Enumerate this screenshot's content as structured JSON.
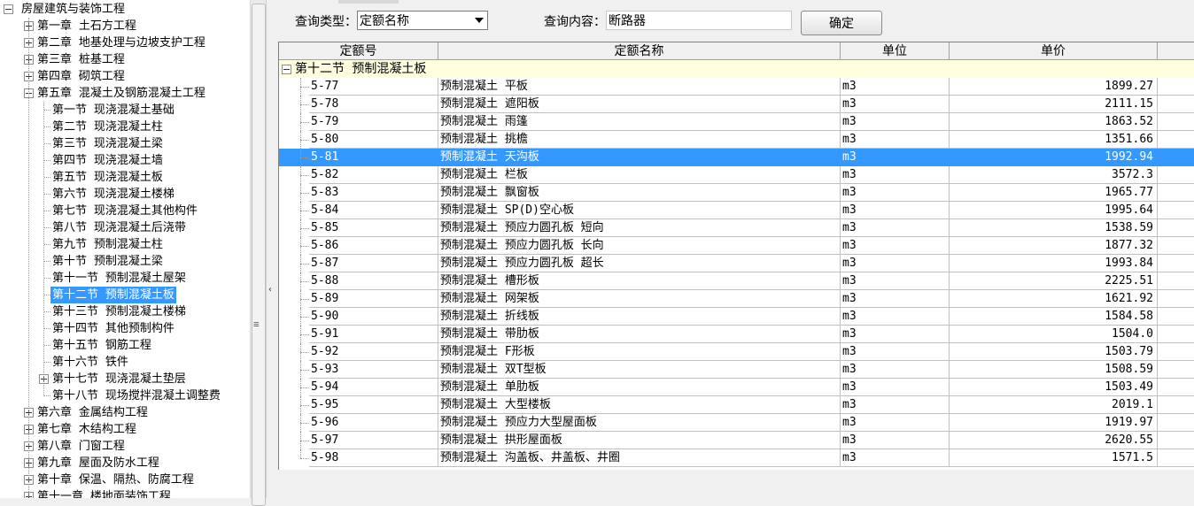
{
  "tree": {
    "root": "房屋建筑与装饰工程",
    "chapters_before": [
      "第一章  土石方工程",
      "第二章  地基处理与边坡支护工程",
      "第三章  桩基工程",
      "第四章  砌筑工程"
    ],
    "expanded_chapter": "第五章  混凝土及钢筋混凝土工程",
    "sections": [
      "第一节  现浇混凝土基础",
      "第二节  现浇混凝土柱",
      "第三节  现浇混凝土梁",
      "第四节  现浇混凝土墙",
      "第五节  现浇混凝土板",
      "第六节  现浇混凝土楼梯",
      "第七节  现浇混凝土其他构件",
      "第八节  现浇混凝土后浇带",
      "第九节  预制混凝土柱",
      "第十节  预制混凝土梁",
      "第十一节  预制混凝土屋架",
      "第十二节  预制混凝土板",
      "第十三节  预制混凝土楼梯",
      "第十四节  其他预制构件",
      "第十五节  钢筋工程",
      "第十六节  铁件",
      "第十七节  现浇混凝土垫层",
      "第十八节  现场搅拌混凝土调整费"
    ],
    "selected_section_index": 11,
    "expandable_section_index": 16,
    "chapters_after": [
      "第六章  金属结构工程",
      "第七章  木结构工程",
      "第八章  门窗工程",
      "第九章  屋面及防水工程",
      "第十章  保温、隔热、防腐工程",
      "第十一章  楼地面装饰工程"
    ]
  },
  "search": {
    "type_label": "查询类型：",
    "type_value": "定额名称",
    "content_label": "查询内容：",
    "content_value": "断路器",
    "confirm_label": "确定"
  },
  "grid": {
    "columns": [
      "定额号",
      "定额名称",
      "单位",
      "单价"
    ],
    "group_label": "第十二节  预制混凝土板",
    "selected_row_index": 4,
    "rows": [
      {
        "code": "5-77",
        "name": "预制混凝土  平板",
        "unit": "m3",
        "price": "1899.27"
      },
      {
        "code": "5-78",
        "name": "预制混凝土  遮阳板",
        "unit": "m3",
        "price": "2111.15"
      },
      {
        "code": "5-79",
        "name": "预制混凝土  雨篷",
        "unit": "m3",
        "price": "1863.52"
      },
      {
        "code": "5-80",
        "name": "预制混凝土  挑檐",
        "unit": "m3",
        "price": "1351.66"
      },
      {
        "code": "5-81",
        "name": "预制混凝土  天沟板",
        "unit": "m3",
        "price": "1992.94"
      },
      {
        "code": "5-82",
        "name": "预制混凝土  栏板",
        "unit": "m3",
        "price": "3572.3"
      },
      {
        "code": "5-83",
        "name": "预制混凝土  飘窗板",
        "unit": "m3",
        "price": "1965.77"
      },
      {
        "code": "5-84",
        "name": "预制混凝土  SP(D)空心板",
        "unit": "m3",
        "price": "1995.64"
      },
      {
        "code": "5-85",
        "name": "预制混凝土  预应力圆孔板  短向",
        "unit": "m3",
        "price": "1538.59"
      },
      {
        "code": "5-86",
        "name": "预制混凝土  预应力圆孔板  长向",
        "unit": "m3",
        "price": "1877.32"
      },
      {
        "code": "5-87",
        "name": "预制混凝土  预应力圆孔板  超长",
        "unit": "m3",
        "price": "1993.84"
      },
      {
        "code": "5-88",
        "name": "预制混凝土  槽形板",
        "unit": "m3",
        "price": "2225.51"
      },
      {
        "code": "5-89",
        "name": "预制混凝土  网架板",
        "unit": "m3",
        "price": "1621.92"
      },
      {
        "code": "5-90",
        "name": "预制混凝土  折线板",
        "unit": "m3",
        "price": "1584.58"
      },
      {
        "code": "5-91",
        "name": "预制混凝土  带肋板",
        "unit": "m3",
        "price": "1504.0"
      },
      {
        "code": "5-92",
        "name": "预制混凝土  F形板",
        "unit": "m3",
        "price": "1503.79"
      },
      {
        "code": "5-93",
        "name": "预制混凝土  双T型板",
        "unit": "m3",
        "price": "1508.59"
      },
      {
        "code": "5-94",
        "name": "预制混凝土  单肋板",
        "unit": "m3",
        "price": "1503.49"
      },
      {
        "code": "5-95",
        "name": "预制混凝土  大型楼板",
        "unit": "m3",
        "price": "2019.1"
      },
      {
        "code": "5-96",
        "name": "预制混凝土  预应力大型屋面板",
        "unit": "m3",
        "price": "1919.97"
      },
      {
        "code": "5-97",
        "name": "预制混凝土  拱形屋面板",
        "unit": "m3",
        "price": "2620.55"
      },
      {
        "code": "5-98",
        "name": "预制混凝土  沟盖板、井盖板、井圈",
        "unit": "m3",
        "price": "1571.5"
      }
    ]
  },
  "colors": {
    "selection": "#3399ff",
    "group_row": "#ffffe0"
  }
}
